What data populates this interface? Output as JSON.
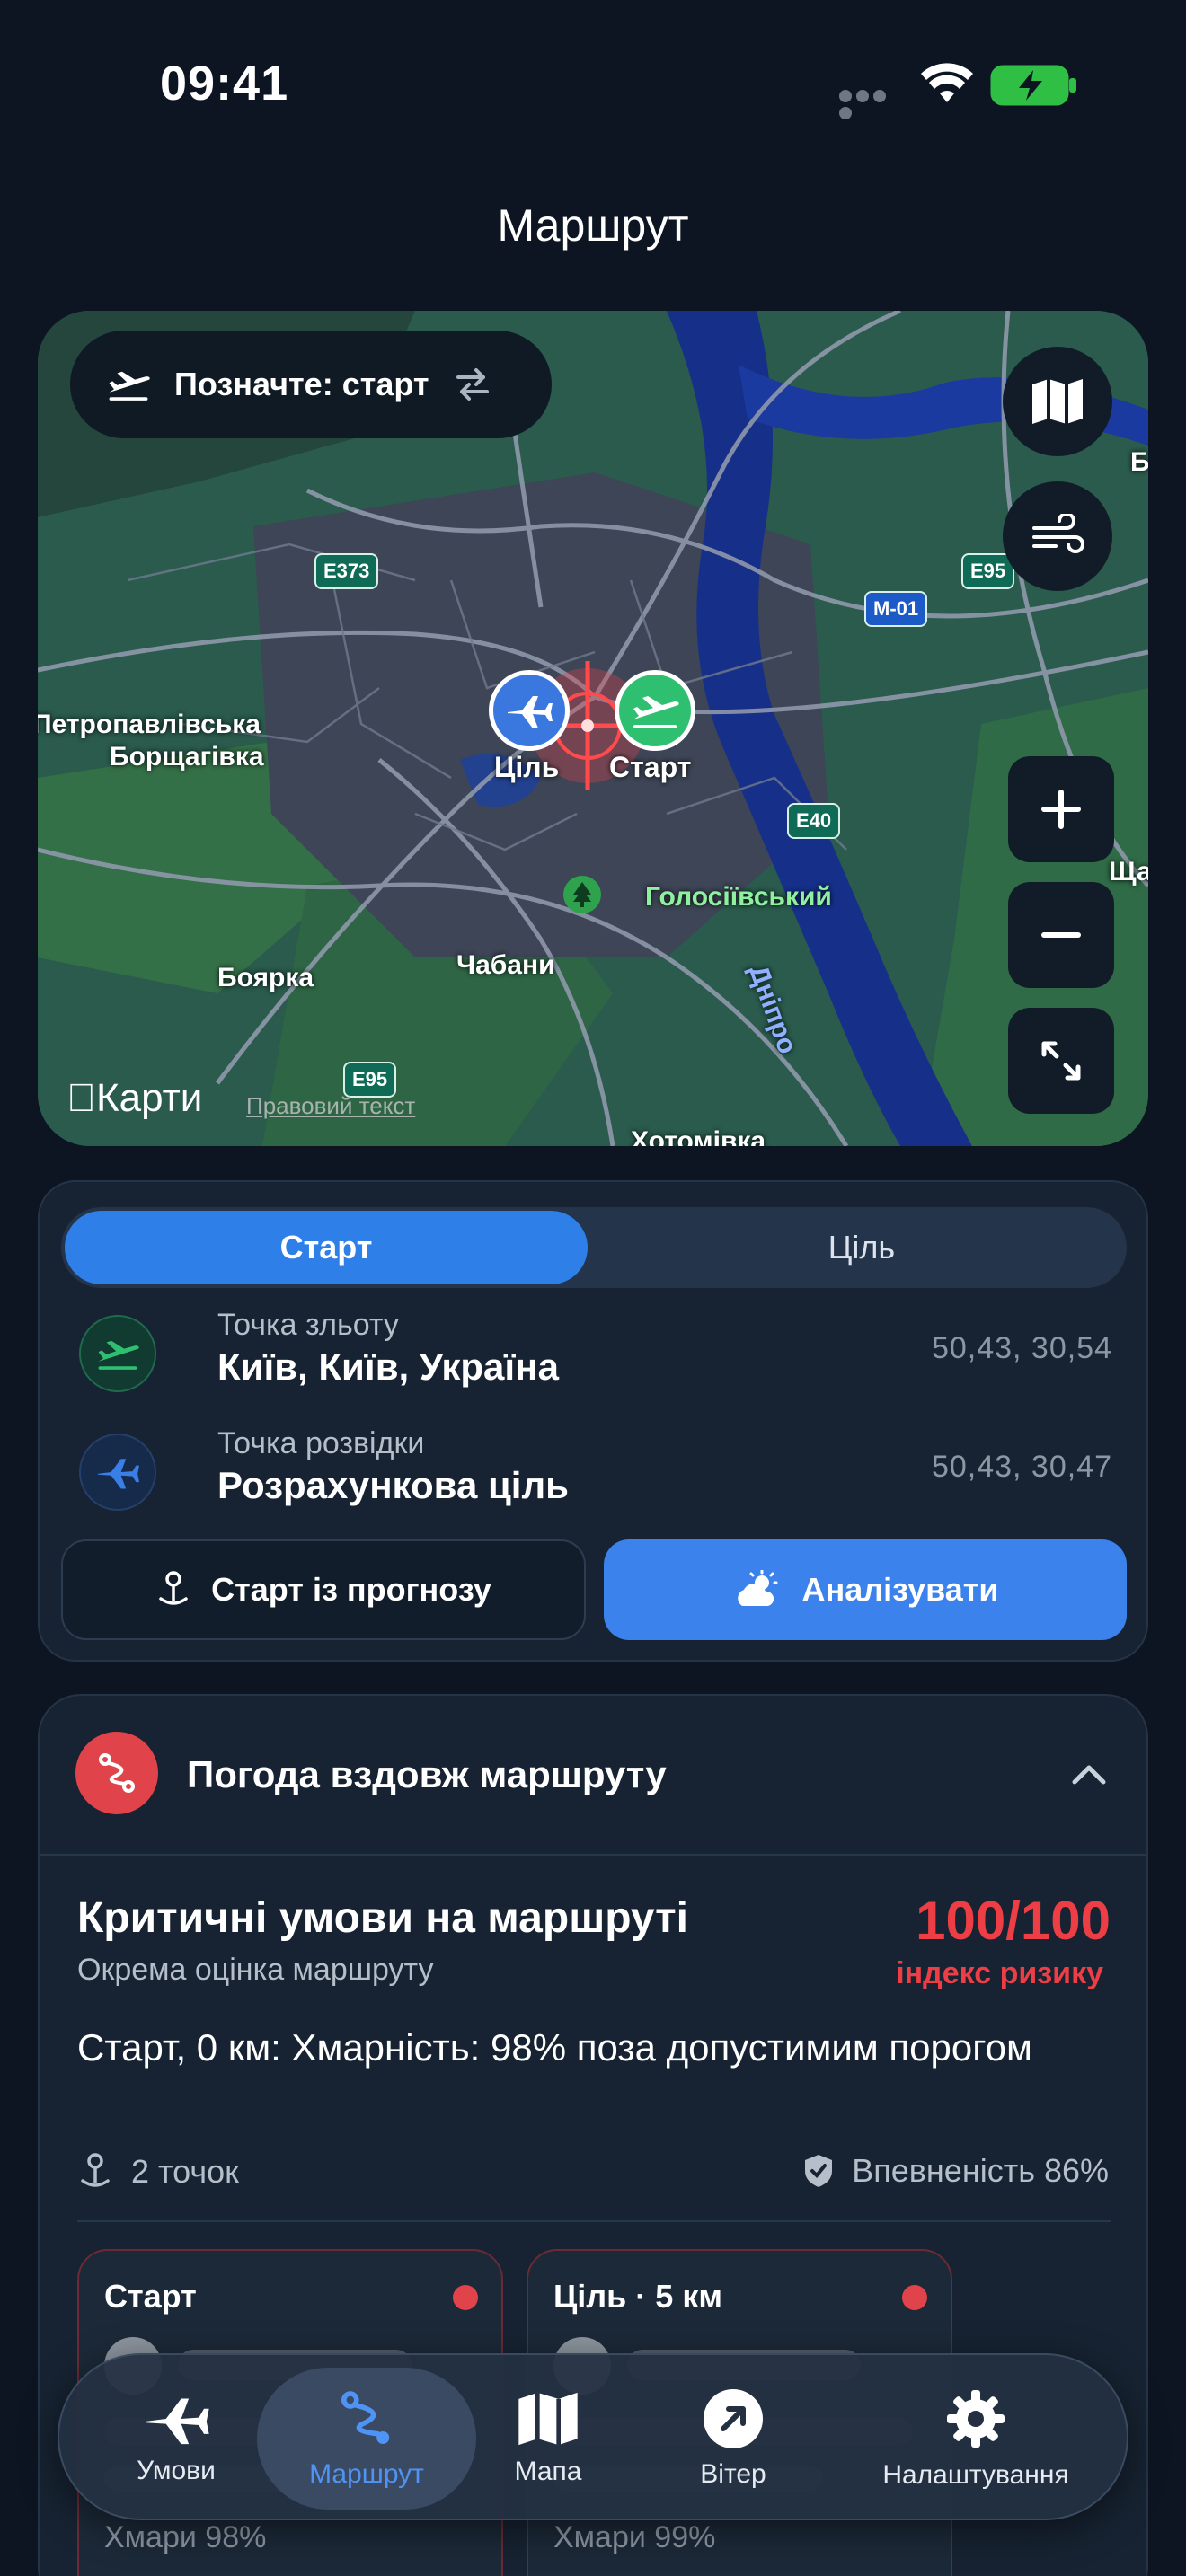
{
  "status_bar": {
    "time": "09:41"
  },
  "page": {
    "title": "Маршрут"
  },
  "map": {
    "mode_pill_label": "Позначте: старт",
    "place_labels": {
      "petro_line1": "Петропавлівська",
      "petro_line2": "Борщагівка",
      "boyarka": "Боярка",
      "chabany": "Чабани",
      "holosiivskyi": "Голосіївський",
      "dnipro": "Дніпро",
      "shcha": "Ща",
      "top_right_b": "Б",
      "bottom_partial": "Хотомівка"
    },
    "marker_target_label": "Ціль",
    "marker_start_label": "Старт",
    "road_shields": [
      "E373",
      "E95",
      "M-01",
      "E40",
      "E95"
    ],
    "logo_text": "Карти",
    "legal_text": "Правовий текст",
    "buttons": [
      "map-style",
      "wind-overlay",
      "zoom-in",
      "zoom-out",
      "expand"
    ]
  },
  "points": {
    "segment_start": "Старт",
    "segment_target": "Ціль",
    "takeoff": {
      "caption": "Точка зльоту",
      "name": "Київ, Київ, Україна",
      "coords": "50,43, 30,54"
    },
    "recon": {
      "caption": "Точка розвідки",
      "name": "Розрахункова ціль",
      "coords": "50,43, 30,47"
    },
    "forecast_button": "Старт із прогнозу",
    "analyze_button": "Аналізувати"
  },
  "route_weather": {
    "header_title": "Погода вздовж маршруту",
    "risk_title": "Критичні умови на маршруті",
    "risk_subtitle": "Окрема оцінка маршруту",
    "risk_score": "100/100",
    "risk_label": "індекс ризику",
    "description": "Старт, 0 км: Хмарність: 98% поза допустимим порогом",
    "points_count": "2 точок",
    "confidence": "Впевненість 86%",
    "legs": [
      {
        "title": "Старт",
        "clouds": "Хмари 98%"
      },
      {
        "title": "Ціль · 5 км",
        "clouds": "Хмари 99%"
      }
    ]
  },
  "tab_bar": {
    "tabs": [
      {
        "label": "Умови"
      },
      {
        "label": "Маршрут"
      },
      {
        "label": "Мапа"
      },
      {
        "label": "Вітер"
      },
      {
        "label": "Налаштування"
      }
    ],
    "active": "Маршрут"
  },
  "colors": {
    "accent_blue": "#2f7fe8",
    "risk_red": "#ec3e44",
    "takeoff_green": "#2fbf71",
    "background": "#0d1522"
  }
}
